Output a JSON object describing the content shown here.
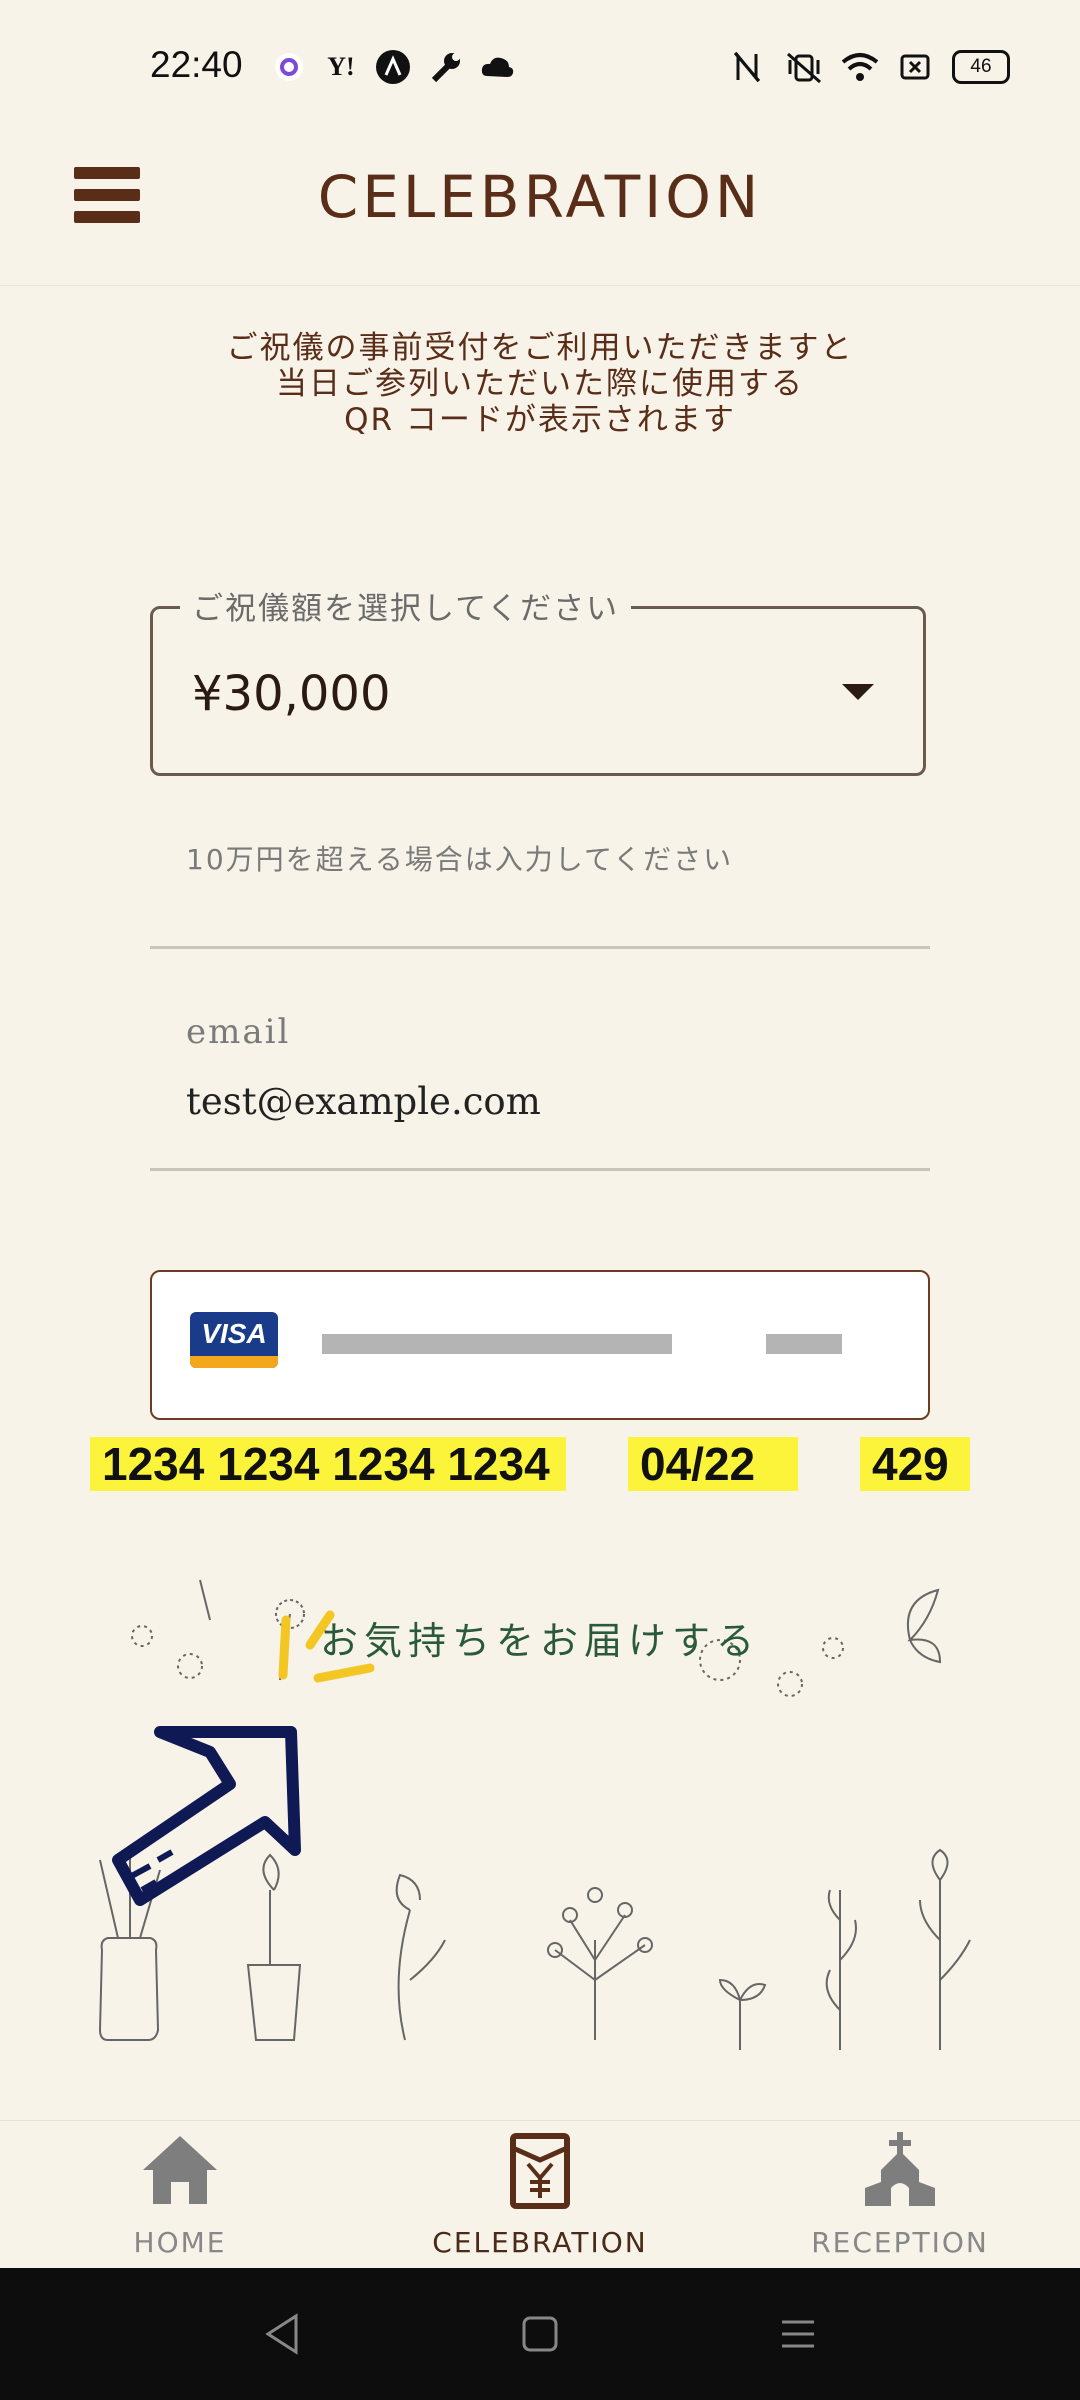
{
  "status_bar": {
    "time": "22:40",
    "battery": "46",
    "left_icons": [
      "circle-app-icon",
      "yahoo-icon",
      "a-app-icon",
      "wrench-icon",
      "cloud-icon"
    ],
    "right_icons": [
      "nfc-icon",
      "vibrate-off-icon",
      "wifi-icon",
      "sim-icon",
      "battery-icon"
    ]
  },
  "app_bar": {
    "title": "CELEBRATION",
    "menu_icon": "hamburger-menu-icon"
  },
  "intro_text": {
    "line1": "ご祝儀の事前受付をご利用いただきますと",
    "line2": "当日ご参列いただいた際に使用する",
    "line3": "QR コードが表示されます"
  },
  "amount_select": {
    "label": "ご祝儀額を選択してください",
    "value": "¥30,000"
  },
  "amount_input": {
    "placeholder": "10万円を超える場合は入力してください"
  },
  "email_field": {
    "label": "email",
    "value": "test@example.com"
  },
  "card_field": {
    "brand": "VISA",
    "hint_number": "1234 1234 1234 1234",
    "hint_expiry": "04/22",
    "hint_cvc": "429"
  },
  "submit": {
    "label": "お気持ちをお届けする"
  },
  "bottom_nav": {
    "items": [
      {
        "label": "HOME",
        "icon": "home-icon"
      },
      {
        "label": "CELEBRATION",
        "icon": "envelope-yen-icon"
      },
      {
        "label": "RECEPTION",
        "icon": "church-icon"
      }
    ],
    "active": "CELEBRATION"
  },
  "colors": {
    "background": "#f7f3e8",
    "brand_brown": "#5a2d18",
    "highlight_yellow": "#fbf43a",
    "submit_green": "#2b5a3a",
    "arrow_navy": "#0f1a55"
  }
}
